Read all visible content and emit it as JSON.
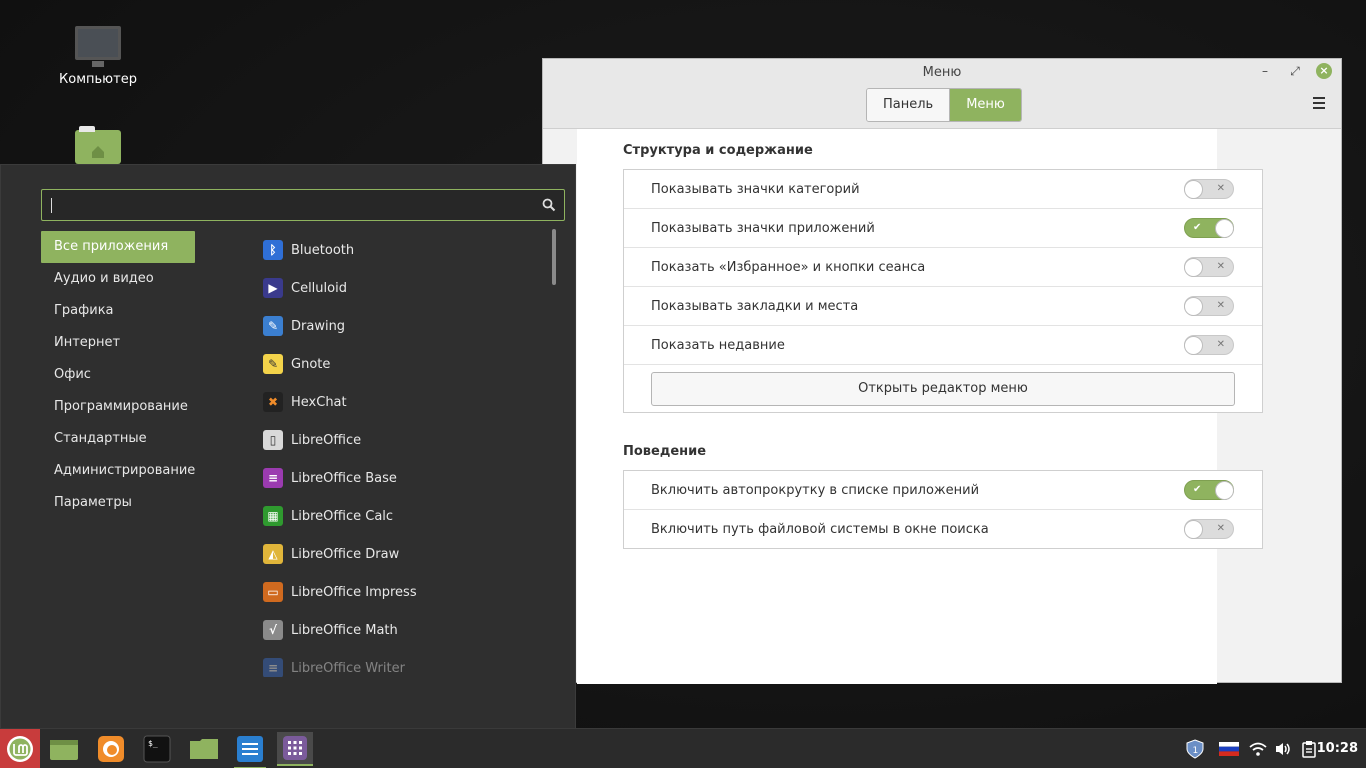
{
  "desktop": {
    "icons": [
      {
        "label": "Компьютер"
      },
      {
        "label": ""
      }
    ]
  },
  "window": {
    "title": "Меню",
    "tabs": [
      {
        "label": "Панель",
        "active": false
      },
      {
        "label": "Меню",
        "active": true
      }
    ],
    "section1": {
      "title": "Структура и содержание",
      "rows": [
        {
          "label": "Показывать значки категорий",
          "state": "off"
        },
        {
          "label": "Показывать значки приложений",
          "state": "on"
        },
        {
          "label": "Показать «Избранное» и кнопки сеанса",
          "state": "off"
        },
        {
          "label": "Показывать закладки и места",
          "state": "off"
        },
        {
          "label": "Показать недавние",
          "state": "off"
        }
      ],
      "editor_button": "Открыть редактор меню"
    },
    "section2": {
      "title": "Поведение",
      "rows": [
        {
          "label": "Включить автопрокрутку в списке приложений",
          "state": "on"
        },
        {
          "label": "Включить путь файловой системы в окне поиска",
          "state": "off"
        }
      ]
    }
  },
  "menu": {
    "search_value": "",
    "categories": [
      "Все приложения",
      "Аудио и видео",
      "Графика",
      "Интернет",
      "Офис",
      "Программирование",
      "Стандартные",
      "Администрирование",
      "Параметры"
    ],
    "active_category": 0,
    "apps": [
      {
        "name": "Bluetooth",
        "icon": "bluetooth-icon",
        "color": "#2f6fd6",
        "glyph": "ᛒ"
      },
      {
        "name": "Celluloid",
        "icon": "celluloid-icon",
        "color": "#3a3a8c",
        "glyph": "▶"
      },
      {
        "name": "Drawing",
        "icon": "drawing-icon",
        "color": "#3b7fd0",
        "glyph": "✎"
      },
      {
        "name": "Gnote",
        "icon": "gnote-icon",
        "color": "#f3d34a",
        "glyph": "✎"
      },
      {
        "name": "HexChat",
        "icon": "hexchat-icon",
        "color": "#222222",
        "glyph": "✖"
      },
      {
        "name": "LibreOffice",
        "icon": "libreoffice-icon",
        "color": "#d9d9d9",
        "glyph": "▯"
      },
      {
        "name": "LibreOffice Base",
        "icon": "libreoffice-base-icon",
        "color": "#9b3bb0",
        "glyph": "≡"
      },
      {
        "name": "LibreOffice Calc",
        "icon": "libreoffice-calc-icon",
        "color": "#2f9a2f",
        "glyph": "▦"
      },
      {
        "name": "LibreOffice Draw",
        "icon": "libreoffice-draw-icon",
        "color": "#e0b53a",
        "glyph": "◭"
      },
      {
        "name": "LibreOffice Impress",
        "icon": "libreoffice-impress-icon",
        "color": "#d06a1f",
        "glyph": "▭"
      },
      {
        "name": "LibreOffice Math",
        "icon": "libreoffice-math-icon",
        "color": "#8a8a8a",
        "glyph": "√"
      },
      {
        "name": "LibreOffice Writer",
        "icon": "libreoffice-writer-icon",
        "color": "#3b6fd0",
        "glyph": "≡"
      }
    ]
  },
  "taskbar": {
    "clock": "10:28",
    "accent": "#8fb35f",
    "items": [
      "mint-menu-icon",
      "files-icon",
      "firefox-icon",
      "terminal-icon",
      "folder-icon",
      "text-editor-icon",
      "app-grid-icon"
    ],
    "tray": [
      "shield-update-icon",
      "russian-flag-icon",
      "wifi-icon",
      "volume-icon",
      "clipboard-icon"
    ]
  }
}
